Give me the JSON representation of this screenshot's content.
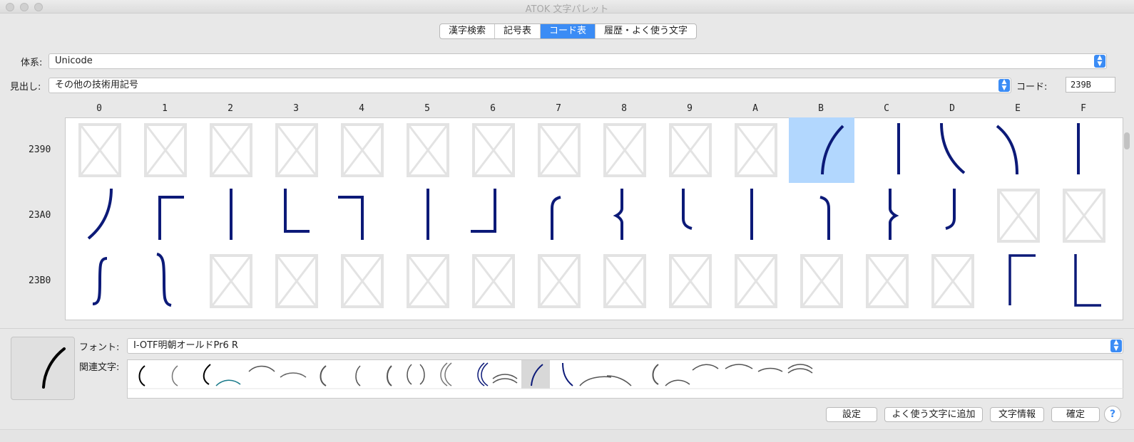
{
  "window": {
    "title": "ATOK 文字パレット"
  },
  "tabs": [
    {
      "label": "漢字検索",
      "active": false
    },
    {
      "label": "記号表",
      "active": false
    },
    {
      "label": "コード表",
      "active": true
    },
    {
      "label": "履歴・よく使う文字",
      "active": false
    }
  ],
  "system": {
    "label": "体系:",
    "value": "Unicode"
  },
  "heading": {
    "label": "見出し:",
    "value": "その他の技術用記号"
  },
  "code": {
    "label": "コード:",
    "value": "239B"
  },
  "table": {
    "columns": [
      "0",
      "1",
      "2",
      "3",
      "4",
      "5",
      "6",
      "7",
      "8",
      "9",
      "A",
      "B",
      "C",
      "D",
      "E",
      "F"
    ],
    "rows": [
      "2390",
      "23A0",
      "23B0"
    ],
    "selected": {
      "row": 0,
      "col": 11
    },
    "glyph_icons": [
      [
        "missing-glyph",
        "missing-glyph",
        "missing-glyph",
        "missing-glyph",
        "missing-glyph",
        "missing-glyph",
        "missing-glyph",
        "missing-glyph",
        "missing-glyph",
        "missing-glyph",
        "missing-glyph",
        "left-paren-upper-hook",
        "left-paren-extension",
        "left-paren-lower-hook",
        "right-paren-upper-hook",
        "right-paren-extension"
      ],
      [
        "right-paren-lower-hook",
        "left-bracket-upper-corner",
        "left-bracket-extension",
        "left-bracket-lower-corner",
        "right-bracket-upper-corner",
        "right-bracket-extension",
        "right-bracket-lower-corner",
        "left-brace-upper-hook",
        "left-brace-middle-piece",
        "left-brace-lower-hook",
        "curly-bracket-extension",
        "right-brace-upper-hook",
        "right-brace-middle-piece",
        "right-brace-lower-hook",
        "missing-glyph",
        "missing-glyph"
      ],
      [
        "integral-extension",
        "horizontal-line-extension",
        "missing-glyph",
        "missing-glyph",
        "missing-glyph",
        "missing-glyph",
        "missing-glyph",
        "missing-glyph",
        "missing-glyph",
        "missing-glyph",
        "missing-glyph",
        "missing-glyph",
        "missing-glyph",
        "missing-glyph",
        "upper-left-corner",
        "lower-left-corner"
      ]
    ]
  },
  "font": {
    "label": "フォント:",
    "value": "I-OTF明朝オールドPr6 R"
  },
  "related": {
    "label": "関連文字:"
  },
  "buttons": {
    "settings": "設定",
    "add_favorite": "よく使う文字に追加",
    "char_info": "文字情報",
    "confirm": "確定",
    "help": "?"
  },
  "colors": {
    "accent": "#3b8cf5",
    "glyph": "#0c1a78",
    "selection": "#b2d7fe",
    "missing": "#e3e3e3"
  }
}
